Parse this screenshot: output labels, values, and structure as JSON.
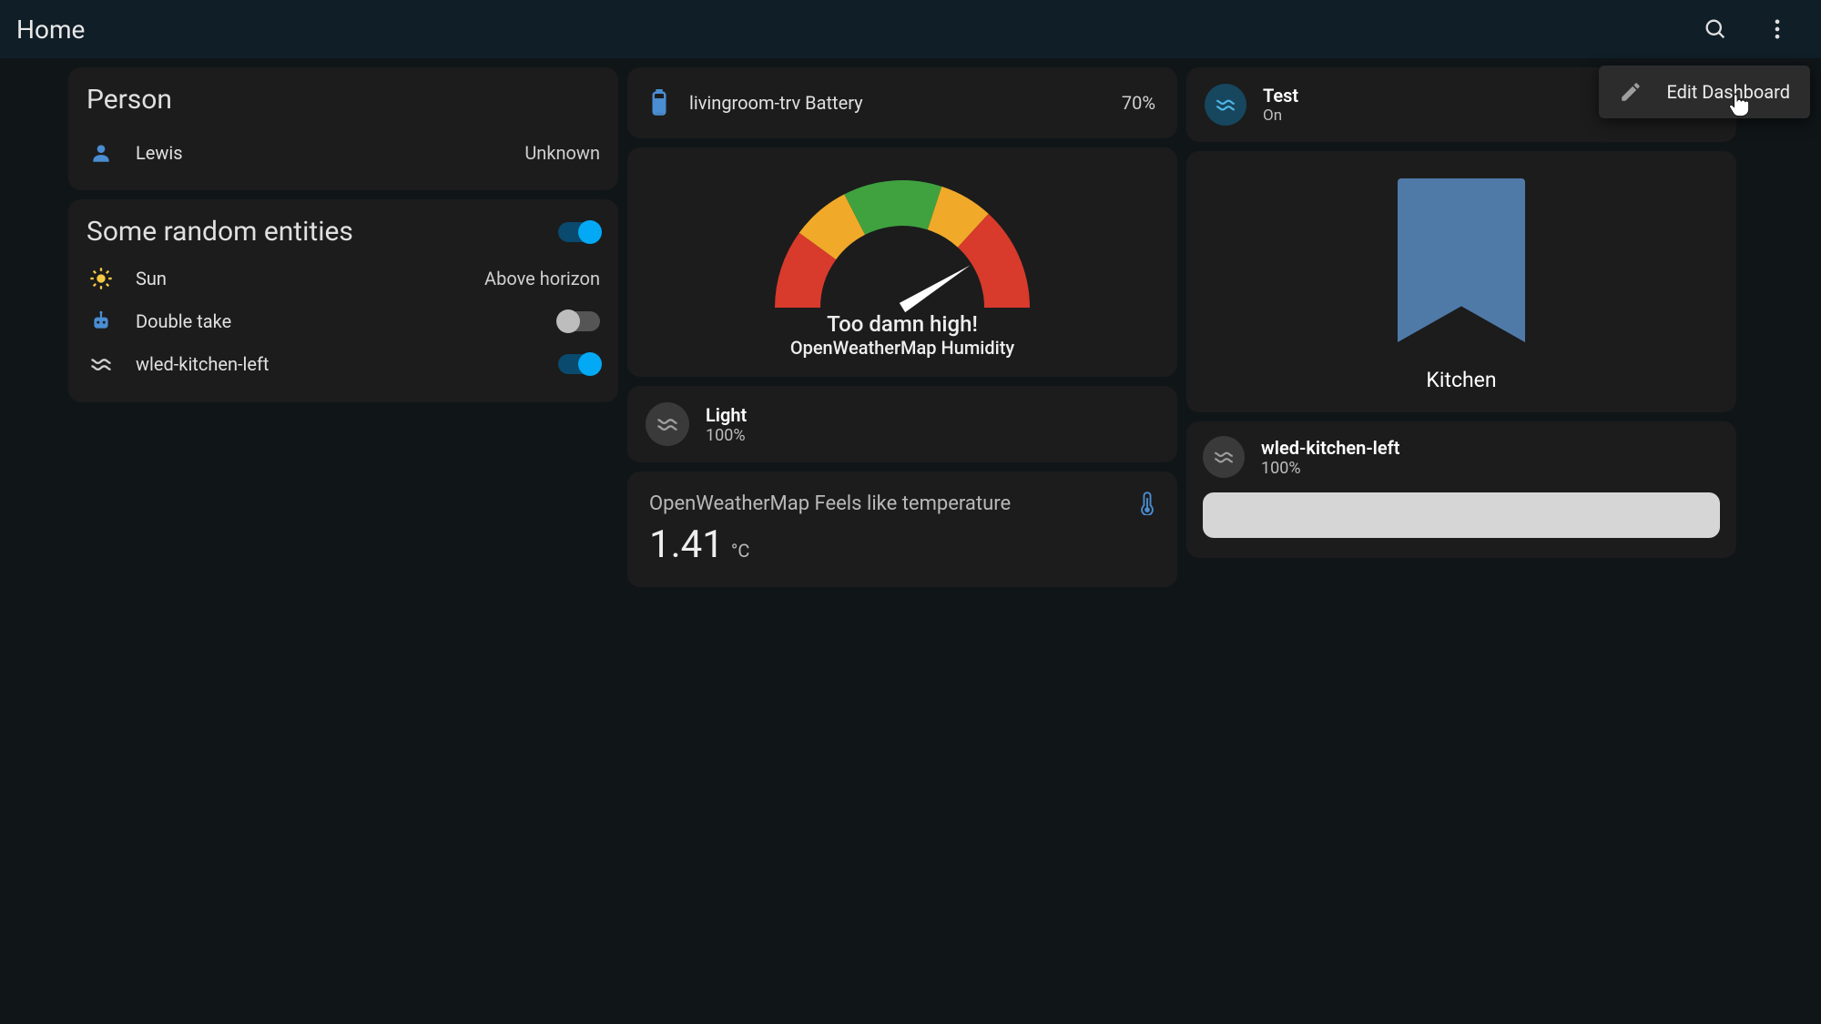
{
  "topbar": {
    "title": "Home"
  },
  "menu": {
    "edit_dashboard": "Edit Dashboard"
  },
  "col1": {
    "person_card": {
      "title": "Person",
      "rows": [
        {
          "name": "Lewis",
          "state": "Unknown"
        }
      ]
    },
    "entities_card": {
      "title": "Some random entities",
      "header_toggle_on": true,
      "rows": [
        {
          "name": "Sun",
          "state": "Above horizon",
          "icon": "sun"
        },
        {
          "name": "Double take",
          "state_toggle": false,
          "icon": "robot"
        },
        {
          "name": "wled-kitchen-left",
          "state_toggle": true,
          "icon": "wave"
        }
      ]
    }
  },
  "col2": {
    "battery_card": {
      "name": "livingroom-trv Battery",
      "value": "70%"
    },
    "gauge_card": {
      "text": "Too damn high!",
      "sub": "OpenWeatherMap Humidity",
      "value_fraction": 0.82
    },
    "light_card": {
      "name": "Light",
      "sub": "100%"
    },
    "sensor_card": {
      "name": "OpenWeatherMap Feels like temperature",
      "value": "1.41",
      "unit": "°C"
    }
  },
  "col3": {
    "test_card": {
      "name": "Test",
      "sub": "On"
    },
    "area_card": {
      "name": "Kitchen"
    },
    "wled_card": {
      "name": "wled-kitchen-left",
      "sub": "100%",
      "slider_pct": 100
    }
  },
  "chart_data": {
    "type": "bar",
    "title": "OpenWeatherMap Humidity",
    "subtitle": "Too damn high!",
    "categories": [
      "humidity"
    ],
    "values": [
      82
    ],
    "ylim": [
      0,
      100
    ],
    "gauge_bands": [
      {
        "from": 0,
        "to": 20,
        "color": "#d83a2b"
      },
      {
        "from": 20,
        "to": 35,
        "color": "#f0a929"
      },
      {
        "from": 35,
        "to": 55,
        "color": "#3fa23f"
      },
      {
        "from": 55,
        "to": 70,
        "color": "#f0a929"
      },
      {
        "from": 70,
        "to": 100,
        "color": "#d83a2b"
      }
    ]
  }
}
